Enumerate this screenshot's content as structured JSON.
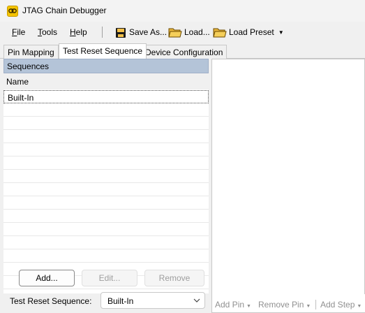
{
  "window": {
    "title": "JTAG Chain Debugger"
  },
  "menu": [
    {
      "prefix": "",
      "accel": "F",
      "rest": "ile"
    },
    {
      "prefix": "",
      "accel": "T",
      "rest": "ools"
    },
    {
      "prefix": "",
      "accel": "H",
      "rest": "elp"
    }
  ],
  "toolbar": {
    "save_label": "Save As...",
    "load_label": "Load...",
    "load_preset_label": "Load Preset"
  },
  "tabs": [
    "Pin Mapping",
    "Test Reset Sequence",
    "Device Configuration"
  ],
  "active_tab": 1,
  "sequences": {
    "header": "Sequences",
    "column_name": "Name",
    "items": [
      "Built-In"
    ],
    "selected_index": 0
  },
  "buttons": {
    "add": "Add...",
    "edit": "Edit...",
    "remove": "Remove"
  },
  "reset": {
    "label": "Test Reset Sequence:",
    "value": "Built-In"
  },
  "steps_toolbar": {
    "add_pin": "Add Pin",
    "remove_pin": "Remove Pin",
    "add_step": "Add Step"
  },
  "colors": {
    "header_bg": "#b4c4d8",
    "folder_yellow": "#f2c04a",
    "app_icon": "#f5c400"
  }
}
